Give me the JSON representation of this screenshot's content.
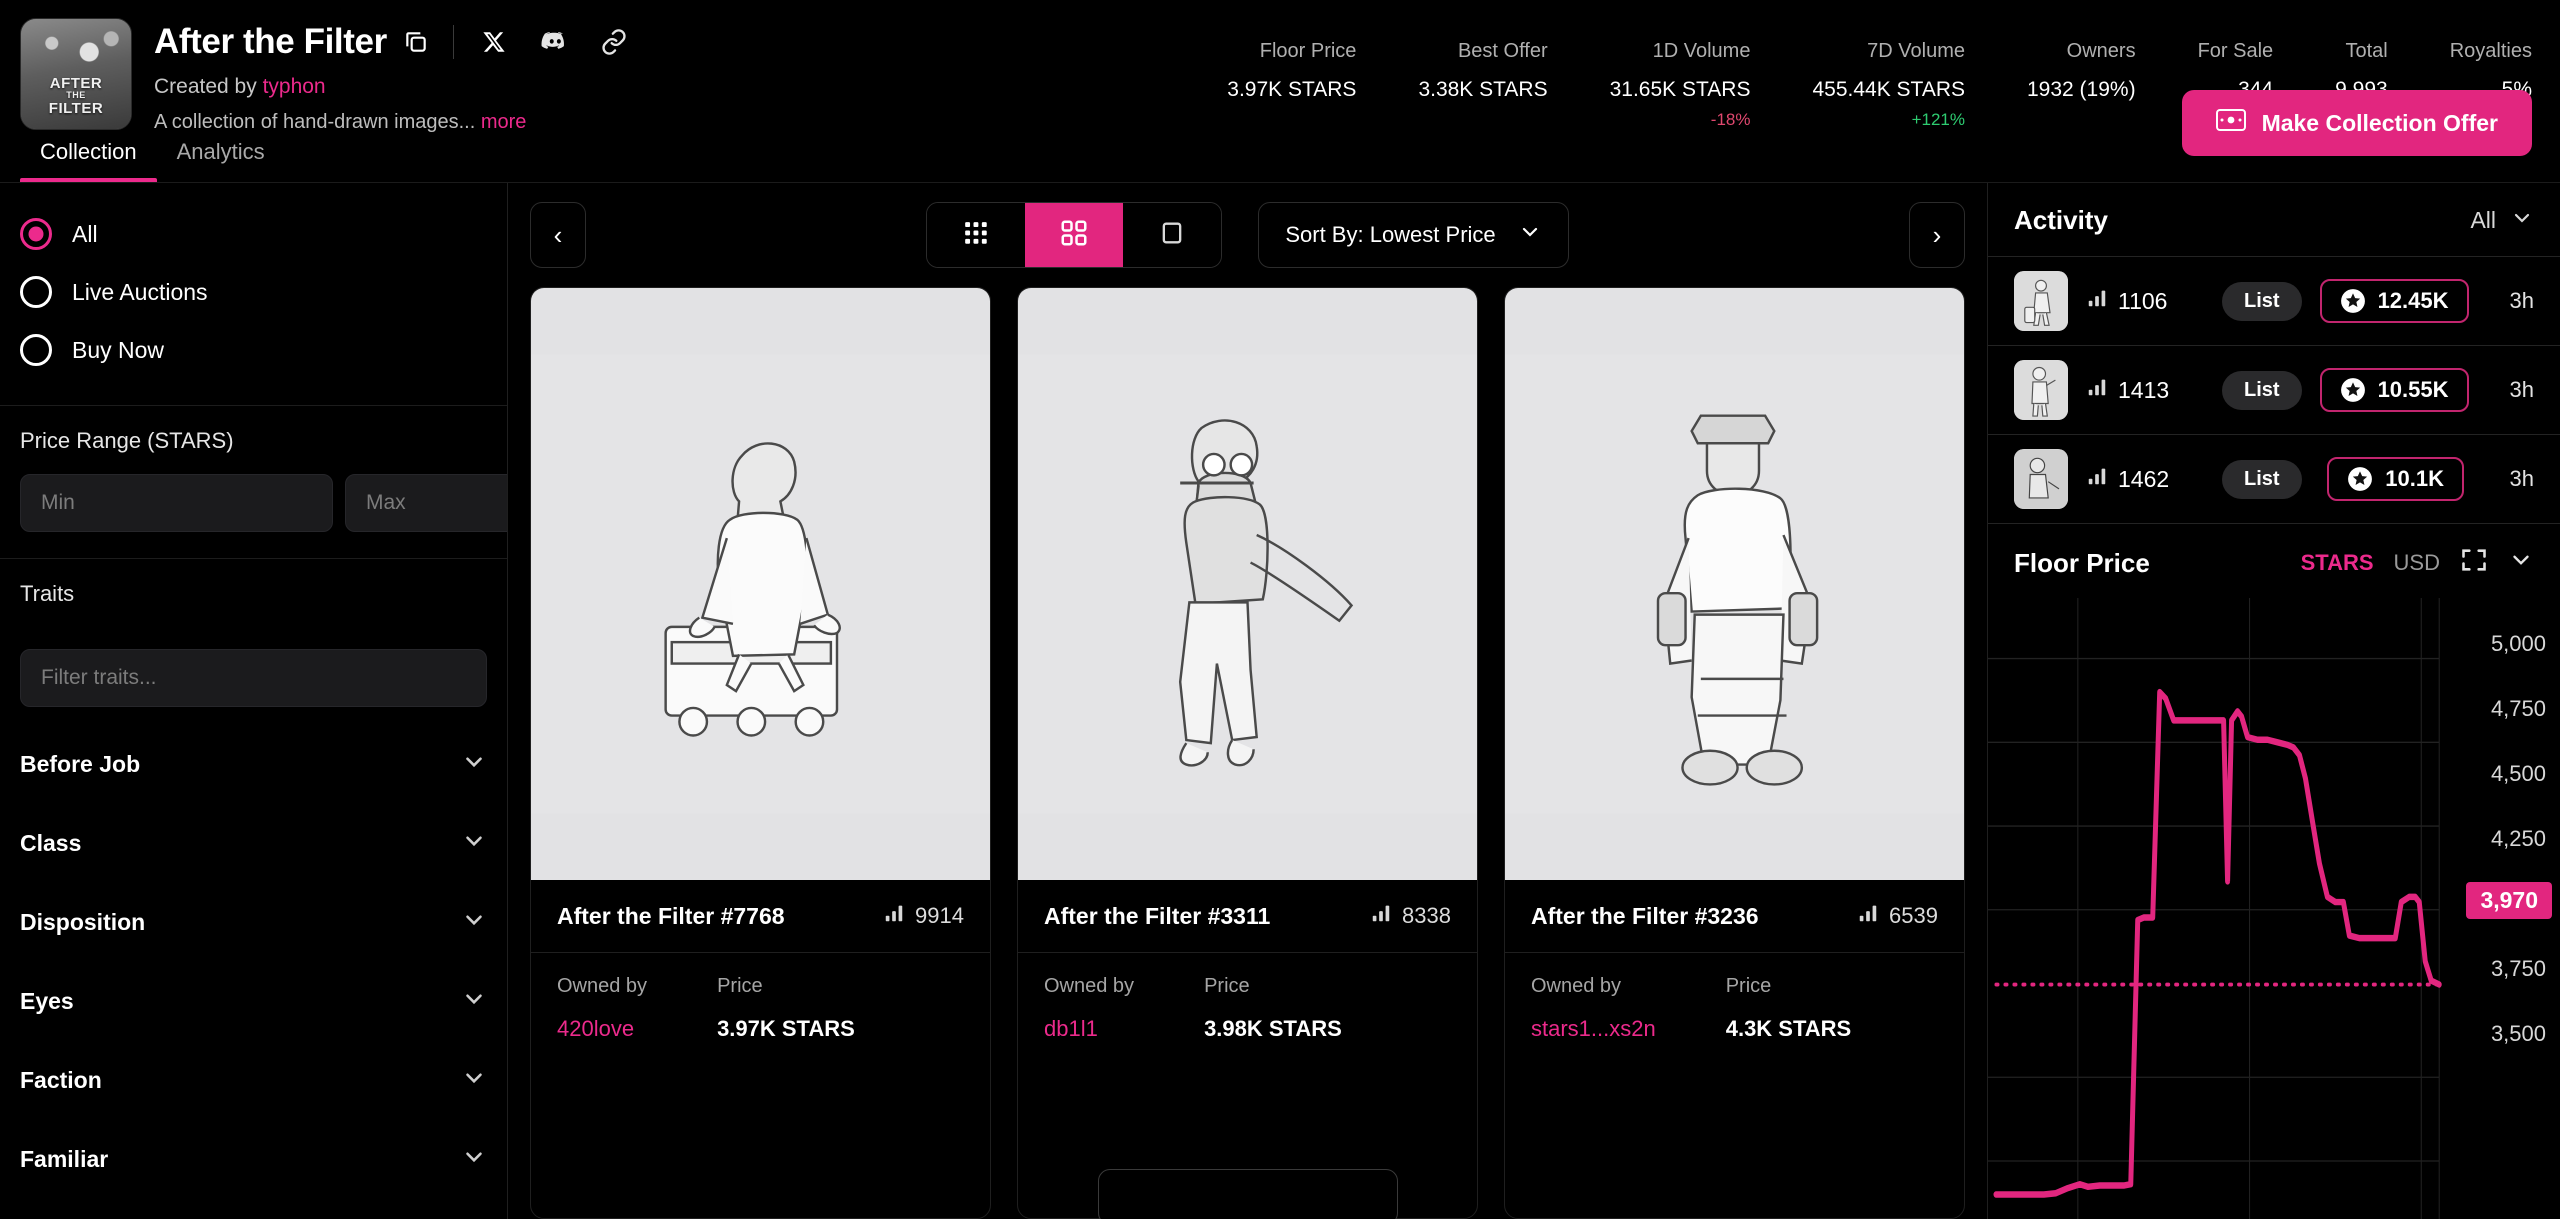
{
  "header": {
    "collection_title": "After the Filter",
    "avatar_text_lines": [
      "AFTER",
      "THE",
      "FILTER"
    ],
    "copy_icon": "copy-icon",
    "social_icons": [
      "x-twitter-icon",
      "discord-icon",
      "link-icon"
    ],
    "created_by_prefix": "Created by ",
    "creator": "typhon",
    "description": "A collection of hand-drawn images...",
    "more_link": "more",
    "stats": [
      {
        "label": "Floor Price",
        "value": "3.97K STARS",
        "delta": "",
        "delta_dir": ""
      },
      {
        "label": "Best Offer",
        "value": "3.38K STARS",
        "delta": "",
        "delta_dir": ""
      },
      {
        "label": "1D Volume",
        "value": "31.65K STARS",
        "delta": "-18%",
        "delta_dir": "neg"
      },
      {
        "label": "7D Volume",
        "value": "455.44K STARS",
        "delta": "+121%",
        "delta_dir": "pos"
      },
      {
        "label": "Owners",
        "value": "1932 (19%)",
        "delta": "",
        "delta_dir": ""
      },
      {
        "label": "For Sale",
        "value": "344",
        "delta": "",
        "delta_dir": ""
      },
      {
        "label": "Total",
        "value": "9,993",
        "delta": "",
        "delta_dir": ""
      },
      {
        "label": "Royalties",
        "value": "5%",
        "delta": "",
        "delta_dir": ""
      }
    ],
    "tabs": [
      {
        "label": "Collection",
        "active": true
      },
      {
        "label": "Analytics",
        "active": false
      }
    ],
    "cta_label": "Make Collection Offer",
    "cta_icon": "banknote-icon"
  },
  "sidebar": {
    "status_options": [
      {
        "label": "All",
        "selected": true
      },
      {
        "label": "Live Auctions",
        "selected": false
      },
      {
        "label": "Buy Now",
        "selected": false
      }
    ],
    "price_range_heading": "Price Range (STARS)",
    "min_placeholder": "Min",
    "max_placeholder": "Max",
    "min_value": "",
    "max_value": "",
    "traits_heading": "Traits",
    "traits_filter_placeholder": "Filter traits...",
    "traits_filter_value": "",
    "trait_groups": [
      {
        "label": "Before Job"
      },
      {
        "label": "Class"
      },
      {
        "label": "Disposition"
      },
      {
        "label": "Eyes"
      },
      {
        "label": "Faction"
      },
      {
        "label": "Familiar"
      }
    ]
  },
  "toolbar": {
    "prev_label": "‹",
    "next_label": "›",
    "views": [
      {
        "icon": "grid-small-icon",
        "active": false
      },
      {
        "icon": "grid-medium-icon",
        "active": true
      },
      {
        "icon": "grid-large-icon",
        "active": false
      }
    ],
    "sort_label": "Sort By: Lowest Price",
    "sort_chevron": "chevron-down-icon"
  },
  "cards": [
    {
      "title": "After the Filter #7768",
      "rank": "9914",
      "rank_icon": "rarity-bars-icon",
      "owned_by_label": "Owned by",
      "owner": "420love",
      "price_label": "Price",
      "price": "3.97K STARS"
    },
    {
      "title": "After the Filter #3311",
      "rank": "8338",
      "rank_icon": "rarity-bars-icon",
      "owned_by_label": "Owned by",
      "owner": "db1l1",
      "price_label": "Price",
      "price": "3.98K STARS"
    },
    {
      "title": "After the Filter #3236",
      "rank": "6539",
      "rank_icon": "rarity-bars-icon",
      "owned_by_label": "Owned by",
      "owner": "stars1...xs2n",
      "price_label": "Price",
      "price": "4.3K STARS"
    }
  ],
  "activity": {
    "title": "Activity",
    "filter_label": "All",
    "filter_chevron": "chevron-down-icon",
    "rows": [
      {
        "rank": "1106",
        "rank_icon": "rarity-bars-icon",
        "type": "List",
        "price": "12.45K",
        "price_icon": "stars-token-icon",
        "time": "3h"
      },
      {
        "rank": "1413",
        "rank_icon": "rarity-bars-icon",
        "type": "List",
        "price": "10.55K",
        "price_icon": "stars-token-icon",
        "time": "3h"
      },
      {
        "rank": "1462",
        "rank_icon": "rarity-bars-icon",
        "type": "List",
        "price": "10.1K",
        "price_icon": "stars-token-icon",
        "time": "3h"
      }
    ]
  },
  "floor_price_panel": {
    "title": "Floor Price",
    "currency_active": "STARS",
    "currency_inactive": "USD",
    "expand_icon": "fullscreen-icon",
    "collapse_icon": "chevron-down-icon",
    "current_value_badge": "3,970"
  },
  "chart_data": {
    "type": "line",
    "title": "Floor Price",
    "xlabel": "",
    "ylabel": "STARS",
    "ylim": [
      3300,
      5150
    ],
    "yticks": [
      5000,
      4750,
      4500,
      4250,
      3750,
      3500
    ],
    "ytick_labels": [
      "5,000",
      "4,750",
      "4,500",
      "4,250",
      "3,750",
      "3,500"
    ],
    "grid": true,
    "legend": false,
    "line_color": "#e2267f",
    "reference_line": {
      "value": 3970,
      "label": "3,970",
      "style": "dotted",
      "color": "#e2267f"
    },
    "series": [
      {
        "name": "Floor Price (STARS)",
        "values": [
          3355,
          3355,
          3355,
          3355,
          3355,
          3355,
          3355,
          3360,
          3372,
          3365,
          3363,
          3366,
          3366,
          3366,
          3368,
          3368,
          4290,
          4290,
          4290,
          4770,
          4690,
          4690,
          4690,
          4690,
          4690,
          4690,
          4690,
          4690,
          4400,
          4690,
          4690,
          4620,
          4590,
          4590,
          4590,
          4580,
          4575,
          4560,
          4420,
          4250,
          4215,
          4215,
          4100,
          4100,
          4100,
          4100,
          4100,
          4100,
          4215,
          4215,
          4100,
          3990,
          3970
        ]
      }
    ]
  },
  "colors": {
    "accent": "#e2267f",
    "accent_light": "#ec2a8c",
    "positive": "#2ecc71",
    "negative": "#e0486f",
    "background": "#000000",
    "panel_border": "#1f1f1f"
  }
}
